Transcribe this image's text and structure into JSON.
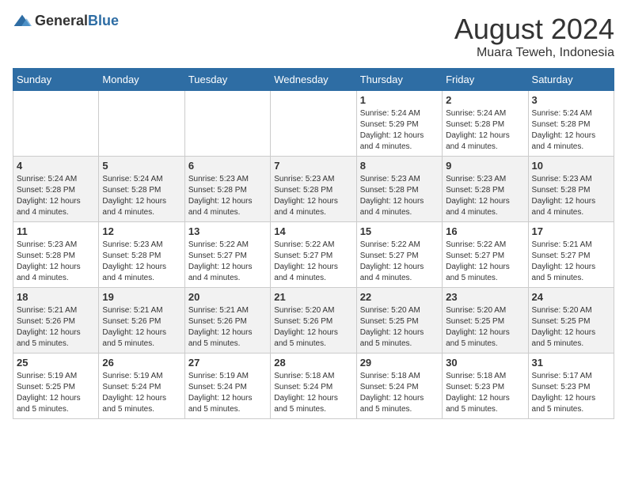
{
  "header": {
    "logo_general": "General",
    "logo_blue": "Blue",
    "month_title": "August 2024",
    "location": "Muara Teweh, Indonesia"
  },
  "days_of_week": [
    "Sunday",
    "Monday",
    "Tuesday",
    "Wednesday",
    "Thursday",
    "Friday",
    "Saturday"
  ],
  "weeks": [
    [
      {
        "day": "",
        "info": ""
      },
      {
        "day": "",
        "info": ""
      },
      {
        "day": "",
        "info": ""
      },
      {
        "day": "",
        "info": ""
      },
      {
        "day": "1",
        "info": "Sunrise: 5:24 AM\nSunset: 5:29 PM\nDaylight: 12 hours and 4 minutes."
      },
      {
        "day": "2",
        "info": "Sunrise: 5:24 AM\nSunset: 5:28 PM\nDaylight: 12 hours and 4 minutes."
      },
      {
        "day": "3",
        "info": "Sunrise: 5:24 AM\nSunset: 5:28 PM\nDaylight: 12 hours and 4 minutes."
      }
    ],
    [
      {
        "day": "4",
        "info": "Sunrise: 5:24 AM\nSunset: 5:28 PM\nDaylight: 12 hours and 4 minutes."
      },
      {
        "day": "5",
        "info": "Sunrise: 5:24 AM\nSunset: 5:28 PM\nDaylight: 12 hours and 4 minutes."
      },
      {
        "day": "6",
        "info": "Sunrise: 5:23 AM\nSunset: 5:28 PM\nDaylight: 12 hours and 4 minutes."
      },
      {
        "day": "7",
        "info": "Sunrise: 5:23 AM\nSunset: 5:28 PM\nDaylight: 12 hours and 4 minutes."
      },
      {
        "day": "8",
        "info": "Sunrise: 5:23 AM\nSunset: 5:28 PM\nDaylight: 12 hours and 4 minutes."
      },
      {
        "day": "9",
        "info": "Sunrise: 5:23 AM\nSunset: 5:28 PM\nDaylight: 12 hours and 4 minutes."
      },
      {
        "day": "10",
        "info": "Sunrise: 5:23 AM\nSunset: 5:28 PM\nDaylight: 12 hours and 4 minutes."
      }
    ],
    [
      {
        "day": "11",
        "info": "Sunrise: 5:23 AM\nSunset: 5:28 PM\nDaylight: 12 hours and 4 minutes."
      },
      {
        "day": "12",
        "info": "Sunrise: 5:23 AM\nSunset: 5:28 PM\nDaylight: 12 hours and 4 minutes."
      },
      {
        "day": "13",
        "info": "Sunrise: 5:22 AM\nSunset: 5:27 PM\nDaylight: 12 hours and 4 minutes."
      },
      {
        "day": "14",
        "info": "Sunrise: 5:22 AM\nSunset: 5:27 PM\nDaylight: 12 hours and 4 minutes."
      },
      {
        "day": "15",
        "info": "Sunrise: 5:22 AM\nSunset: 5:27 PM\nDaylight: 12 hours and 4 minutes."
      },
      {
        "day": "16",
        "info": "Sunrise: 5:22 AM\nSunset: 5:27 PM\nDaylight: 12 hours and 5 minutes."
      },
      {
        "day": "17",
        "info": "Sunrise: 5:21 AM\nSunset: 5:27 PM\nDaylight: 12 hours and 5 minutes."
      }
    ],
    [
      {
        "day": "18",
        "info": "Sunrise: 5:21 AM\nSunset: 5:26 PM\nDaylight: 12 hours and 5 minutes."
      },
      {
        "day": "19",
        "info": "Sunrise: 5:21 AM\nSunset: 5:26 PM\nDaylight: 12 hours and 5 minutes."
      },
      {
        "day": "20",
        "info": "Sunrise: 5:21 AM\nSunset: 5:26 PM\nDaylight: 12 hours and 5 minutes."
      },
      {
        "day": "21",
        "info": "Sunrise: 5:20 AM\nSunset: 5:26 PM\nDaylight: 12 hours and 5 minutes."
      },
      {
        "day": "22",
        "info": "Sunrise: 5:20 AM\nSunset: 5:25 PM\nDaylight: 12 hours and 5 minutes."
      },
      {
        "day": "23",
        "info": "Sunrise: 5:20 AM\nSunset: 5:25 PM\nDaylight: 12 hours and 5 minutes."
      },
      {
        "day": "24",
        "info": "Sunrise: 5:20 AM\nSunset: 5:25 PM\nDaylight: 12 hours and 5 minutes."
      }
    ],
    [
      {
        "day": "25",
        "info": "Sunrise: 5:19 AM\nSunset: 5:25 PM\nDaylight: 12 hours and 5 minutes."
      },
      {
        "day": "26",
        "info": "Sunrise: 5:19 AM\nSunset: 5:24 PM\nDaylight: 12 hours and 5 minutes."
      },
      {
        "day": "27",
        "info": "Sunrise: 5:19 AM\nSunset: 5:24 PM\nDaylight: 12 hours and 5 minutes."
      },
      {
        "day": "28",
        "info": "Sunrise: 5:18 AM\nSunset: 5:24 PM\nDaylight: 12 hours and 5 minutes."
      },
      {
        "day": "29",
        "info": "Sunrise: 5:18 AM\nSunset: 5:24 PM\nDaylight: 12 hours and 5 minutes."
      },
      {
        "day": "30",
        "info": "Sunrise: 5:18 AM\nSunset: 5:23 PM\nDaylight: 12 hours and 5 minutes."
      },
      {
        "day": "31",
        "info": "Sunrise: 5:17 AM\nSunset: 5:23 PM\nDaylight: 12 hours and 5 minutes."
      }
    ]
  ]
}
